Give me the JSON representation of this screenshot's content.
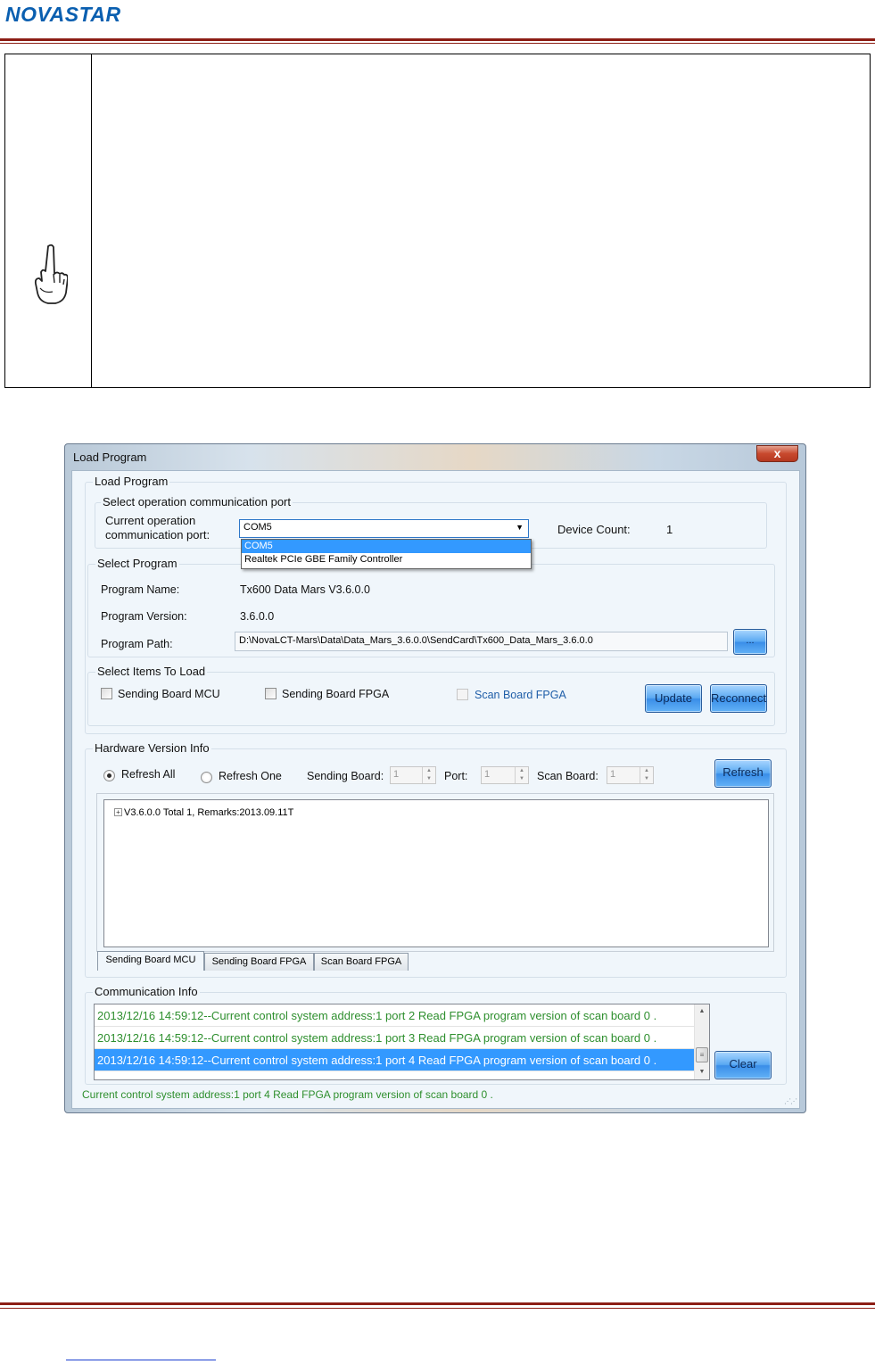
{
  "doc": {
    "logo_part1": "NOVA",
    "logo_part2": "STAR",
    "note_icon": "pointing-hand-icon"
  },
  "window": {
    "title": "Load Program",
    "close_glyph": "x"
  },
  "load_program": {
    "group_title": "Load Program",
    "port_group_title": "Select operation communication port",
    "current_port_label_line1": "Current operation",
    "current_port_label_line2": "communication port:",
    "port_selected": "COM5",
    "port_options": [
      "COM5",
      "Realtek PCIe GBE Family Controller"
    ],
    "device_count_label": "Device Count:",
    "device_count_value": "1"
  },
  "select_program": {
    "group_title": "Select Program",
    "name_label": "Program Name:",
    "name_value": "Tx600  Data  Mars  V3.6.0.0",
    "version_label": "Program Version:",
    "version_value": "3.6.0.0",
    "path_label": "Program Path:",
    "path_value": "D:\\NovaLCT-Mars\\Data\\Data_Mars_3.6.0.0\\SendCard\\Tx600_Data_Mars_3.6.0.0",
    "browse_label": "..."
  },
  "items_to_load": {
    "group_title": "Select Items To Load",
    "sending_mcu": "Sending Board MCU",
    "sending_fpga": "Sending Board FPGA",
    "scan_fpga": "Scan Board FPGA",
    "update_label": "Update",
    "reconnect_label": "Reconnect"
  },
  "hardware": {
    "group_title": "Hardware Version Info",
    "refresh_all": "Refresh All",
    "refresh_one": "Refresh One",
    "sending_board_label": "Sending Board:",
    "sending_board_value": "1",
    "port_label": "Port:",
    "port_value": "1",
    "scan_board_label": "Scan Board:",
    "scan_board_value": "1",
    "refresh_label": "Refresh",
    "tree_item": "V3.6.0.0 Total 1, Remarks:2013.09.11T",
    "tabs": [
      "Sending Board MCU",
      "Sending Board FPGA",
      "Scan Board FPGA"
    ]
  },
  "communication": {
    "group_title": "Communication Info",
    "log": [
      "2013/12/16 14:59:12--Current control system address:1 port 2 Read FPGA program version of scan board 0 .",
      "2013/12/16 14:59:12--Current control system address:1 port 3 Read FPGA program version of scan board 0 .",
      "2013/12/16 14:59:12--Current control system address:1 port 4 Read FPGA program version of scan board 0 ."
    ],
    "clear_label": "Clear",
    "status": "Current control system address:1 port 4 Read FPGA program version of scan board 0 ."
  },
  "colors": {
    "brand_blue": "#0a5fb0",
    "brand_orange": "#e59a1a",
    "rule_red": "#8c1d14",
    "log_green": "#2e8f2e",
    "selection_blue": "#3399ff"
  }
}
